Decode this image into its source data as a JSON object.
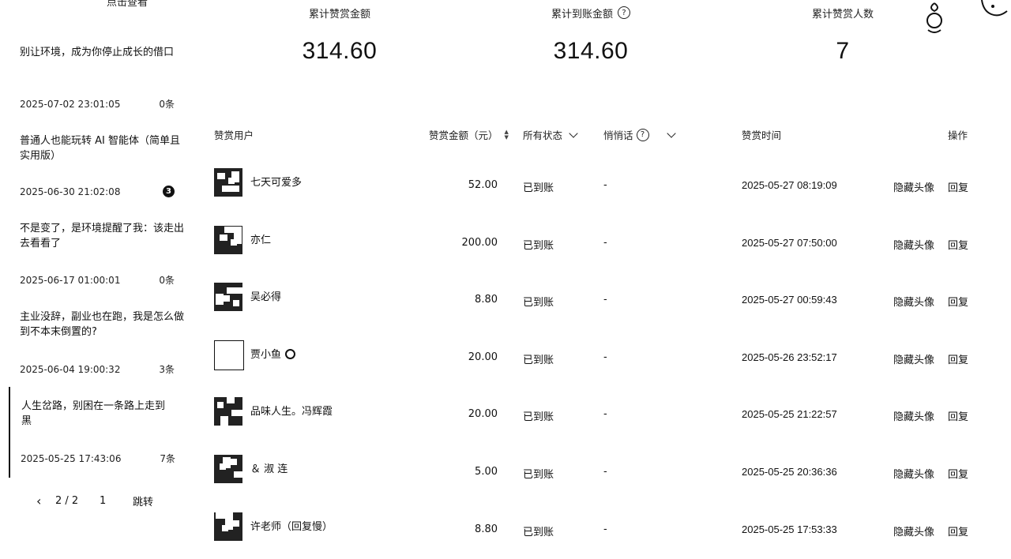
{
  "sidebar": {
    "top_link": "点击查看",
    "articles": [
      {
        "title": "别让环境，成为你停止成长的借口",
        "date": "2025-07-02 23:01:05",
        "count": "0条",
        "badge": ""
      },
      {
        "title": "普通人也能玩转 AI 智能体（简单且实用版）",
        "date": "2025-06-30 21:02:08",
        "count": "",
        "badge": "3"
      },
      {
        "title": "不是变了，是环境提醒了我：该走出去看看了",
        "date": "2025-06-17 01:00:01",
        "count": "0条",
        "badge": ""
      },
      {
        "title": "主业没辞，副业也在跑，我是怎么做到不本末倒置的?",
        "date": "2025-06-04 19:00:32",
        "count": "3条",
        "badge": ""
      },
      {
        "title": "人生岔路，别困在一条路上走到黑",
        "date": "2025-05-25 17:43:06",
        "count": "7条",
        "badge": ""
      }
    ],
    "pager": {
      "prev": "‹",
      "page": "2 / 2",
      "input": "1",
      "jump": "跳转"
    }
  },
  "stats": {
    "total_amount_label": "累计赞赏金额",
    "total_amount": "314.60",
    "received_label": "累计到账金额",
    "received": "314.60",
    "people_label": "累计赞赏人数",
    "people": "7"
  },
  "table": {
    "headers": {
      "user": "赞赏用户",
      "amount": "赞赏金额（元）",
      "status": "所有状态",
      "message": "悄悄话",
      "time": "赞赏时间",
      "action": "操作"
    },
    "rows": [
      {
        "user": "七天可爱多",
        "amount": "52.00",
        "status": "已到账",
        "message": "-",
        "time": "2025-05-27 08:19:09",
        "hide": "隐藏头像",
        "reply": "回复"
      },
      {
        "user": "亦仁",
        "amount": "200.00",
        "status": "已到账",
        "message": "-",
        "time": "2025-05-27 07:50:00",
        "hide": "隐藏头像",
        "reply": "回复"
      },
      {
        "user": "吴必得",
        "amount": "8.80",
        "status": "已到账",
        "message": "-",
        "time": "2025-05-27 00:59:43",
        "hide": "隐藏头像",
        "reply": "回复"
      },
      {
        "user": "贾小鱼",
        "amount": "20.00",
        "status": "已到账",
        "message": "-",
        "time": "2025-05-26 23:52:17",
        "hide": "隐藏头像",
        "reply": "回复"
      },
      {
        "user": "品味人生。冯辉霞",
        "amount": "20.00",
        "status": "已到账",
        "message": "-",
        "time": "2025-05-25 21:22:57",
        "hide": "隐藏头像",
        "reply": "回复"
      },
      {
        "user": "＆ 淑 连",
        "amount": "5.00",
        "status": "已到账",
        "message": "-",
        "time": "2025-05-25 20:36:36",
        "hide": "隐藏头像",
        "reply": "回复"
      },
      {
        "user": "许老师（回复慢）",
        "amount": "8.80",
        "status": "已到账",
        "message": "-",
        "time": "2025-05-25 17:53:33",
        "hide": "隐藏头像",
        "reply": "回复"
      }
    ]
  }
}
